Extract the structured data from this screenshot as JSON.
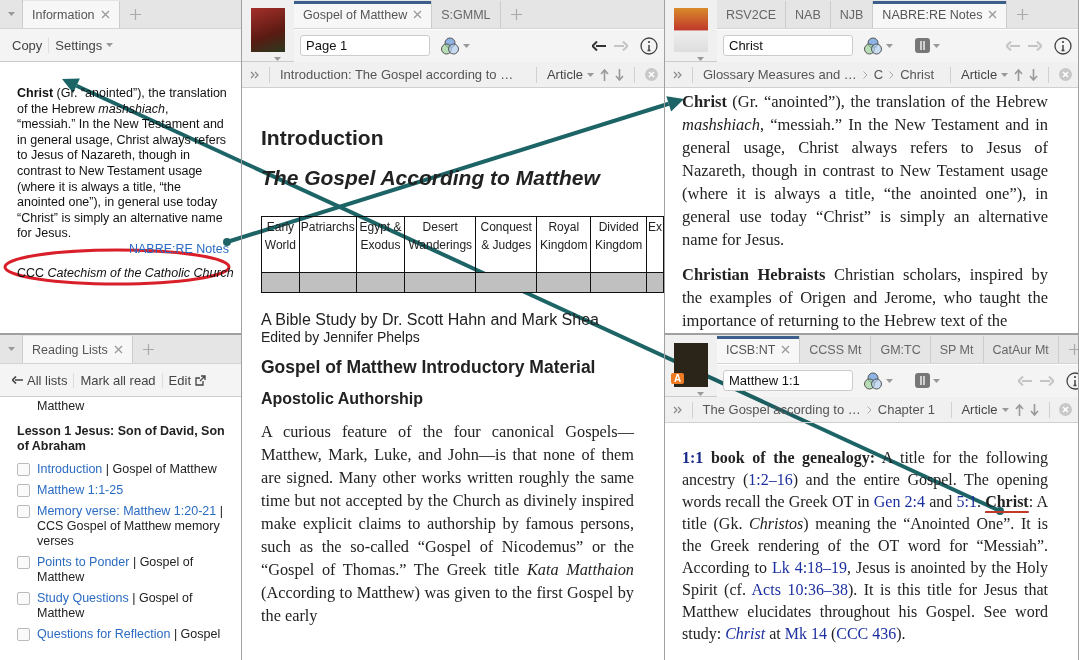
{
  "info_panel": {
    "tabs": [
      {
        "label": "Information",
        "selected": true
      }
    ],
    "toolbar": [
      {
        "label": "Copy",
        "kind": "plain"
      },
      {
        "label": "Settings",
        "kind": "menu"
      }
    ],
    "entry": "**Christ** (Gr. “anointed”), the translation of the Hebrew *mashshiach*, “messiah.” In the New Testament and in general usage, Christ always refers to Jesus of Nazareth, though in contrast to New Testament usage (where it is always a title, “the anointed one”), in general use today “Christ” is simply an alternative name for Jesus.",
    "source": "NABRE:RE Notes",
    "ccc": "CCC *Catechism of the Catholic Church*"
  },
  "reading_panel": {
    "tabs": [
      {
        "label": "Reading Lists",
        "selected": true
      }
    ],
    "toolbar": [
      {
        "label": "All lists",
        "kind": "back"
      },
      {
        "label": "Mark all read",
        "kind": "plain"
      },
      {
        "label": "Edit",
        "kind": "external"
      }
    ],
    "above": "Matthew",
    "lesson": "Lesson 1 Jesus: Son of David, Son of Abraham",
    "items": [
      {
        "link": "Introduction",
        "source": "| Gospel of Matthew",
        "checked": false
      },
      {
        "link": "Matthew 1:1-25",
        "checked": false
      },
      {
        "link": "Memory verse: Matthew 1:20-21",
        "source": "| CCS Gospel of Matthew memory verses",
        "checked": false
      },
      {
        "link": "Points to Ponder",
        "source": "| Gospel of Matthew",
        "checked": false
      },
      {
        "link": "Study Questions",
        "source": "| Gospel of Matthew",
        "checked": false
      },
      {
        "link": "Questions for Reflection",
        "source": "| Gospel",
        "checked": false
      }
    ]
  },
  "book_panels": [
    {
      "tabs": [
        {
          "label": "Gospel of Matthew",
          "selected": true
        },
        {
          "label": "S:GMML",
          "selected": false
        }
      ],
      "reference": "Page 1",
      "layout_button": false,
      "back_enabled": true,
      "breadcrumb": [
        "Introduction: The Gospel according to …"
      ],
      "view": "Article",
      "content": {
        "kind": "article",
        "blocks": [
          {
            "kind": "h1",
            "text": "Introduction"
          },
          {
            "kind": "h1i",
            "text": "The Gospel According to Matthew"
          },
          {
            "kind": "table",
            "columns": [
              "Early World",
              "Patriarchs",
              "Egypt & Exodus",
              "Desert Wanderings",
              "Conquest & Judges",
              "Royal Kingdom",
              "Divided Kingdom",
              "Ex"
            ]
          },
          {
            "kind": "byline",
            "text": "A Bible Study by Dr. Scott Hahn and Mark Shea"
          },
          {
            "kind": "editor",
            "text": "Edited by Jennifer Phelps"
          },
          {
            "kind": "h2",
            "text": "Gospel of Matthew Introductory Material"
          },
          {
            "kind": "h3",
            "text": "Apostolic Authorship"
          },
          {
            "kind": "para",
            "text": "A curious feature of the four canonical Gospels—Matthew, Mark, Luke, and John—is that none of them are signed. Many other works written roughly the same time but not accepted by the Church as divinely inspired make explicit claims to authorship by famous persons, such as the so-called “Gospel of Nicodemus” or the “Gospel of Thomas.” The Greek title *Kata Matthaion* (According to Matthew) was given to the first Gospel by the early"
          }
        ]
      }
    },
    {
      "tabs": [
        {
          "label": "RSV2CE",
          "selected": false
        },
        {
          "label": "NAB",
          "selected": false
        },
        {
          "label": "NJB",
          "selected": false
        },
        {
          "label": "NABRE:RE Notes",
          "selected": true
        }
      ],
      "reference": "Christ",
      "layout_button": true,
      "back_enabled": false,
      "breadcrumb": [
        "Glossary Measures and …",
        "C",
        "Christ"
      ],
      "view": "Article",
      "content": {
        "kind": "glossary",
        "entries": [
          {
            "term": "Christ",
            "text": "(Gr. “anointed”), the translation of the Hebrew *mashshiach*, “messiah.” In the New Testament and in general usage, Christ always refers to Jesus of Nazareth, though in contrast to New Testament usage (where it is always a title, “the anointed one”), in general use today “Christ” is simply an alternative name for Jesus."
          },
          {
            "term": "Christian Hebraists",
            "text": "Christian scholars, inspired by the examples of Origen and Jerome, who taught the importance of returning to the Hebrew text of the"
          }
        ]
      }
    },
    {
      "tabs": [
        {
          "label": "ICSB:NT",
          "selected": true
        },
        {
          "label": "CCSS Mt",
          "selected": false
        },
        {
          "label": "GM:TC",
          "selected": false
        },
        {
          "label": "SP Mt",
          "selected": false
        },
        {
          "label": "CatAur Mt",
          "selected": false
        }
      ],
      "badge": "A",
      "reference": "Matthew 1:1",
      "layout_button": true,
      "back_enabled": false,
      "breadcrumb": [
        "The Gospel according to …",
        "Chapter 1"
      ],
      "view": "Article",
      "content": {
        "kind": "note",
        "segments": [
          {
            "kind": "ref",
            "text": "1:1"
          },
          {
            "kind": "bold",
            "text": " book of the genealogy:"
          },
          {
            "kind": "plain",
            "text": " A title for the following ancestry ("
          },
          {
            "kind": "link",
            "text": "1:2–16"
          },
          {
            "kind": "plain",
            "text": ") and the entire Gospel. The opening words recall the Greek OT in "
          },
          {
            "kind": "link",
            "text": "Gen 2:4"
          },
          {
            "kind": "plain",
            "text": " and "
          },
          {
            "kind": "link",
            "text": "5:1"
          },
          {
            "kind": "plain",
            "text": ". "
          },
          {
            "kind": "marked",
            "text": "Christ"
          },
          {
            "kind": "plain",
            "text": ": A title (Gk. *Christos*) meaning the “Anointed One”. It is the Greek rendering of the OT word for “Messiah”. According to "
          },
          {
            "kind": "link",
            "text": "Lk 4:18–19"
          },
          {
            "kind": "plain",
            "text": ", Jesus is anointed by the Holy Spirit (cf. "
          },
          {
            "kind": "link",
            "text": "Acts 10:36–38"
          },
          {
            "kind": "plain",
            "text": "). It is this title for Jesus that Matthew elucidates throughout his Gospel. See word study: "
          },
          {
            "kind": "link",
            "text": "*Christ*"
          },
          {
            "kind": "plain",
            "text": " at "
          },
          {
            "kind": "link",
            "text": "Mk 14"
          },
          {
            "kind": "plain",
            "text": " ("
          },
          {
            "kind": "link",
            "text": "CCC 436"
          },
          {
            "kind": "plain",
            "text": ")."
          }
        ]
      }
    }
  ]
}
